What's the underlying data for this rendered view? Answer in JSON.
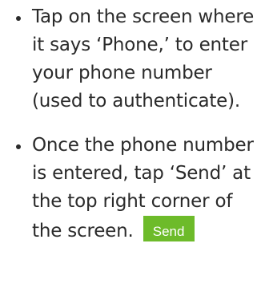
{
  "instructions": [
    {
      "text": "Tap on the screen where it says ‘Phone,’ to enter your phone number (used to authenticate)."
    },
    {
      "text": "Once the phone number is entered, tap ‘Send’ at the top right corner of the screen.",
      "inline_button_label": "Send"
    }
  ],
  "colors": {
    "text": "#2b2b2b",
    "send_button_background": "#6dbb2a",
    "send_button_text": "#ffffff"
  }
}
